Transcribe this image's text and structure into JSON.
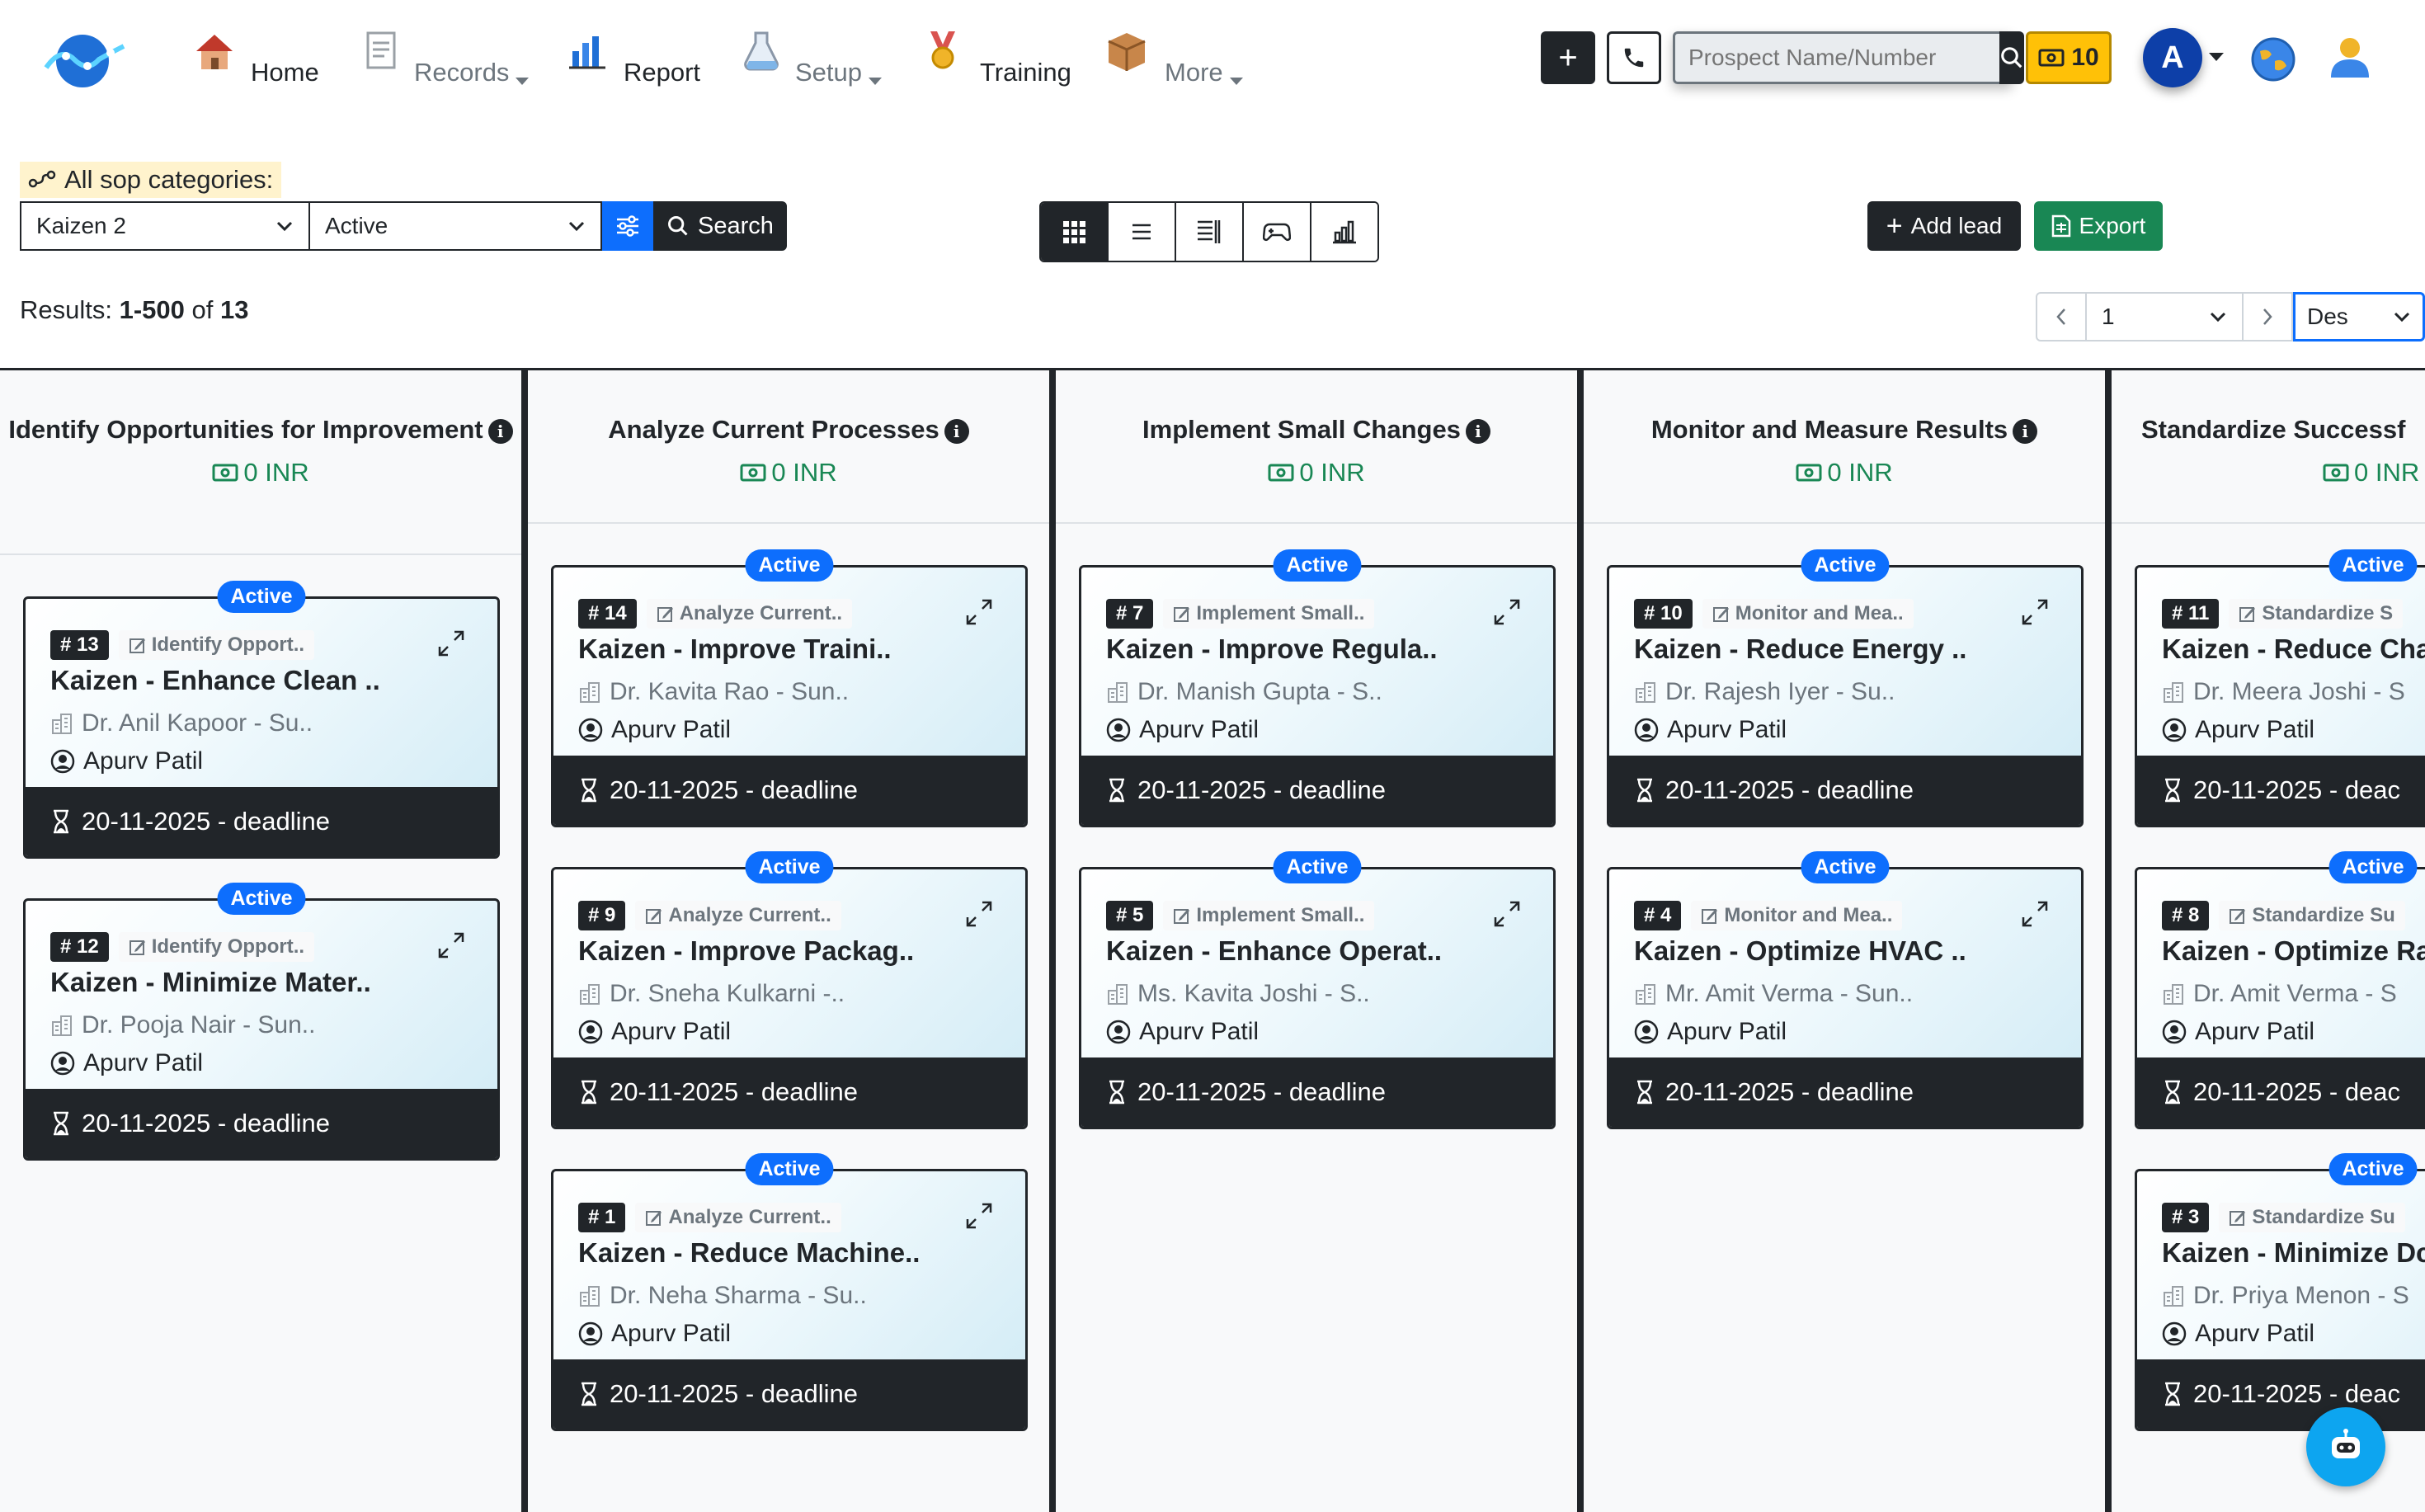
{
  "nav": {
    "home": "Home",
    "records": "Records",
    "report": "Report",
    "setup": "Setup",
    "training": "Training",
    "more": "More",
    "search_placeholder": "Prospect Name/Number",
    "coins": "10",
    "avatar_letter": "A"
  },
  "filters": {
    "sop_label": "All sop categories:",
    "category_value": "Kaizen 2",
    "status_value": "Active",
    "search_label": "Search",
    "add_lead_label": "Add lead",
    "export_label": "Export"
  },
  "results": {
    "prefix": "Results:",
    "range": "1-500",
    "of": "of",
    "total": "13"
  },
  "pager": {
    "page": "1",
    "sort": "Des"
  },
  "colors": {
    "primary": "#0d6efd",
    "dark": "#212529",
    "success": "#198754",
    "warning": "#ffc107"
  },
  "board": {
    "columns": [
      {
        "title": "Identify Opportunities for Improvement",
        "amount": "0 INR",
        "cards": [
          {
            "status": "Active",
            "num": "# 13",
            "stage": "Identify Opport..",
            "title": "Kaizen - Enhance Clean ..",
            "doctor": "Dr. Anil Kapoor - Su..",
            "owner": "Apurv Patil",
            "deadline": "20-11-2025 - deadline"
          },
          {
            "status": "Active",
            "num": "# 12",
            "stage": "Identify Opport..",
            "title": "Kaizen - Minimize Mater..",
            "doctor": "Dr. Pooja Nair - Sun..",
            "owner": "Apurv Patil",
            "deadline": "20-11-2025 - deadline"
          }
        ]
      },
      {
        "title": "Analyze Current Processes",
        "amount": "0 INR",
        "cards": [
          {
            "status": "Active",
            "num": "# 14",
            "stage": "Analyze Current..",
            "title": "Kaizen - Improve Traini..",
            "doctor": "Dr. Kavita Rao - Sun..",
            "owner": "Apurv Patil",
            "deadline": "20-11-2025 - deadline"
          },
          {
            "status": "Active",
            "num": "# 9",
            "stage": "Analyze Current..",
            "title": "Kaizen - Improve Packag..",
            "doctor": "Dr. Sneha Kulkarni -..",
            "owner": "Apurv Patil",
            "deadline": "20-11-2025 - deadline"
          },
          {
            "status": "Active",
            "num": "# 1",
            "stage": "Analyze Current..",
            "title": "Kaizen - Reduce Machine..",
            "doctor": "Dr. Neha Sharma - Su..",
            "owner": "Apurv Patil",
            "deadline": "20-11-2025 - deadline"
          }
        ]
      },
      {
        "title": "Implement Small Changes",
        "amount": "0 INR",
        "cards": [
          {
            "status": "Active",
            "num": "# 7",
            "stage": "Implement Small..",
            "title": "Kaizen - Improve Regula..",
            "doctor": "Dr. Manish Gupta - S..",
            "owner": "Apurv Patil",
            "deadline": "20-11-2025 - deadline"
          },
          {
            "status": "Active",
            "num": "# 5",
            "stage": "Implement Small..",
            "title": "Kaizen - Enhance Operat..",
            "doctor": "Ms. Kavita Joshi - S..",
            "owner": "Apurv Patil",
            "deadline": "20-11-2025 - deadline"
          }
        ]
      },
      {
        "title": "Monitor and Measure Results",
        "amount": "0 INR",
        "cards": [
          {
            "status": "Active",
            "num": "# 10",
            "stage": "Monitor and Mea..",
            "title": "Kaizen - Reduce Energy ..",
            "doctor": "Dr. Rajesh Iyer - Su..",
            "owner": "Apurv Patil",
            "deadline": "20-11-2025 - deadline"
          },
          {
            "status": "Active",
            "num": "# 4",
            "stage": "Monitor and Mea..",
            "title": "Kaizen - Optimize HVAC ..",
            "doctor": "Mr. Amit Verma - Sun..",
            "owner": "Apurv Patil",
            "deadline": "20-11-2025 - deadline"
          }
        ]
      },
      {
        "title": "Standardize Successf",
        "amount": "0 INR",
        "cards": [
          {
            "status": "Active",
            "num": "# 11",
            "stage": "Standardize S",
            "title": "Kaizen - Reduce Cha",
            "doctor": "Dr. Meera Joshi - S",
            "owner": "Apurv Patil",
            "deadline": "20-11-2025 - deac"
          },
          {
            "status": "Active",
            "num": "# 8",
            "stage": "Standardize Su",
            "title": "Kaizen - Optimize Ra",
            "doctor": "Dr. Amit Verma - S",
            "owner": "Apurv Patil",
            "deadline": "20-11-2025 - deac"
          },
          {
            "status": "Active",
            "num": "# 3",
            "stage": "Standardize Su",
            "title": "Kaizen - Minimize Dc",
            "doctor": "Dr. Priya Menon - S",
            "owner": "Apurv Patil",
            "deadline": "20-11-2025 - deac"
          }
        ]
      }
    ]
  }
}
